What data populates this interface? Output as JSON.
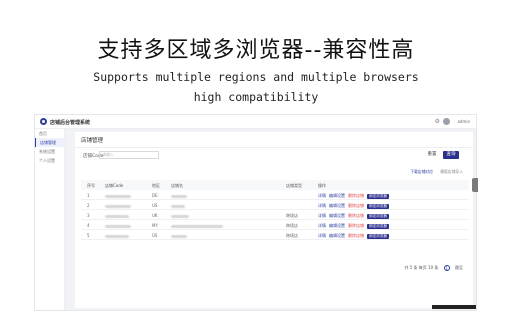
{
  "promo": {
    "headline": "支持多区域多浏览器--兼容性高",
    "sub_line1": "Supports multiple regions and multiple browsers",
    "sub_line2": "high compatibility"
  },
  "app": {
    "title": "店铺后台管理系统",
    "username": "admin",
    "sidebar": [
      {
        "label": "首页",
        "active": false
      },
      {
        "label": "店铺管理",
        "active": true
      },
      {
        "label": "系统设置",
        "active": false
      },
      {
        "label": "个人设置",
        "active": false
      }
    ],
    "page_title": "店铺管理",
    "filter": {
      "label": "店铺Code",
      "placeholder": "请输入"
    },
    "buttons": {
      "reset": "重置",
      "query": "查询"
    },
    "table_tools": {
      "add": "下载店铺对应",
      "export": "模版店铺导入"
    },
    "columns": [
      "序号",
      "店铺Code",
      "地区",
      "店铺名",
      "店铺类型",
      "操作"
    ],
    "rows": [
      {
        "no": "1",
        "area": "DE",
        "type": "",
        "ops": [
          "详情",
          "编辑设置",
          "删除店铺"
        ],
        "tag": "绑定浏览器"
      },
      {
        "no": "2",
        "area": "US",
        "type": "",
        "ops": [
          "详情",
          "编辑设置",
          "删除店铺"
        ],
        "tag": "绑定浏览器"
      },
      {
        "no": "3",
        "area": "UK",
        "type": "跨境店",
        "ops": [
          "详情",
          "编辑设置",
          "删除店铺"
        ],
        "tag": "绑定浏览器"
      },
      {
        "no": "4",
        "area": "MY",
        "type": "跨境店",
        "ops": [
          "详情",
          "编辑设置",
          "删除店铺"
        ],
        "tag": "绑定浏览器"
      },
      {
        "no": "5",
        "area": "US",
        "type": "跨境店",
        "ops": [
          "详情",
          "编辑设置",
          "删除店铺"
        ],
        "tag": "绑定浏览器"
      }
    ],
    "pager": {
      "summary": "共 5 条 每页 10 条",
      "page": "1",
      "goto": "跳至"
    }
  },
  "colors": {
    "accent": "#2b2f8e",
    "danger": "#e04848",
    "link": "#2a3fa0"
  }
}
